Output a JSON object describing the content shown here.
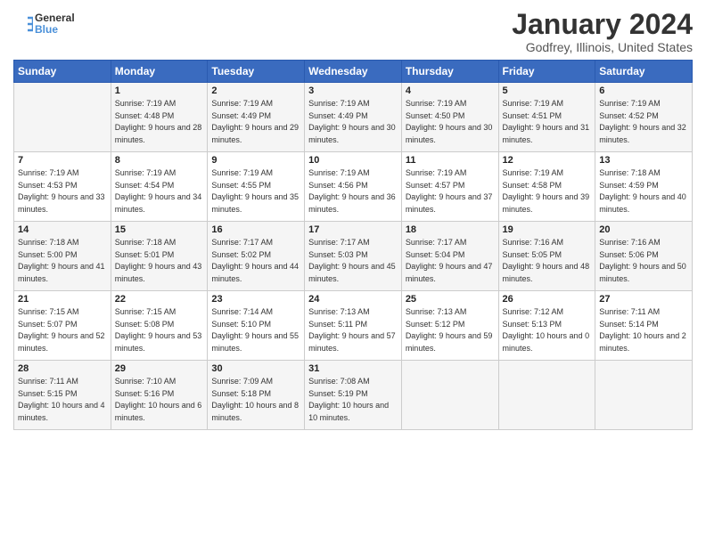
{
  "header": {
    "logo_line1": "General",
    "logo_line2": "Blue",
    "title": "January 2024",
    "location": "Godfrey, Illinois, United States"
  },
  "days_of_week": [
    "Sunday",
    "Monday",
    "Tuesday",
    "Wednesday",
    "Thursday",
    "Friday",
    "Saturday"
  ],
  "weeks": [
    [
      {
        "day": "",
        "sunrise": "",
        "sunset": "",
        "daylight": ""
      },
      {
        "day": "1",
        "sunrise": "Sunrise: 7:19 AM",
        "sunset": "Sunset: 4:48 PM",
        "daylight": "Daylight: 9 hours and 28 minutes."
      },
      {
        "day": "2",
        "sunrise": "Sunrise: 7:19 AM",
        "sunset": "Sunset: 4:49 PM",
        "daylight": "Daylight: 9 hours and 29 minutes."
      },
      {
        "day": "3",
        "sunrise": "Sunrise: 7:19 AM",
        "sunset": "Sunset: 4:49 PM",
        "daylight": "Daylight: 9 hours and 30 minutes."
      },
      {
        "day": "4",
        "sunrise": "Sunrise: 7:19 AM",
        "sunset": "Sunset: 4:50 PM",
        "daylight": "Daylight: 9 hours and 30 minutes."
      },
      {
        "day": "5",
        "sunrise": "Sunrise: 7:19 AM",
        "sunset": "Sunset: 4:51 PM",
        "daylight": "Daylight: 9 hours and 31 minutes."
      },
      {
        "day": "6",
        "sunrise": "Sunrise: 7:19 AM",
        "sunset": "Sunset: 4:52 PM",
        "daylight": "Daylight: 9 hours and 32 minutes."
      }
    ],
    [
      {
        "day": "7",
        "sunrise": "Sunrise: 7:19 AM",
        "sunset": "Sunset: 4:53 PM",
        "daylight": "Daylight: 9 hours and 33 minutes."
      },
      {
        "day": "8",
        "sunrise": "Sunrise: 7:19 AM",
        "sunset": "Sunset: 4:54 PM",
        "daylight": "Daylight: 9 hours and 34 minutes."
      },
      {
        "day": "9",
        "sunrise": "Sunrise: 7:19 AM",
        "sunset": "Sunset: 4:55 PM",
        "daylight": "Daylight: 9 hours and 35 minutes."
      },
      {
        "day": "10",
        "sunrise": "Sunrise: 7:19 AM",
        "sunset": "Sunset: 4:56 PM",
        "daylight": "Daylight: 9 hours and 36 minutes."
      },
      {
        "day": "11",
        "sunrise": "Sunrise: 7:19 AM",
        "sunset": "Sunset: 4:57 PM",
        "daylight": "Daylight: 9 hours and 37 minutes."
      },
      {
        "day": "12",
        "sunrise": "Sunrise: 7:19 AM",
        "sunset": "Sunset: 4:58 PM",
        "daylight": "Daylight: 9 hours and 39 minutes."
      },
      {
        "day": "13",
        "sunrise": "Sunrise: 7:18 AM",
        "sunset": "Sunset: 4:59 PM",
        "daylight": "Daylight: 9 hours and 40 minutes."
      }
    ],
    [
      {
        "day": "14",
        "sunrise": "Sunrise: 7:18 AM",
        "sunset": "Sunset: 5:00 PM",
        "daylight": "Daylight: 9 hours and 41 minutes."
      },
      {
        "day": "15",
        "sunrise": "Sunrise: 7:18 AM",
        "sunset": "Sunset: 5:01 PM",
        "daylight": "Daylight: 9 hours and 43 minutes."
      },
      {
        "day": "16",
        "sunrise": "Sunrise: 7:17 AM",
        "sunset": "Sunset: 5:02 PM",
        "daylight": "Daylight: 9 hours and 44 minutes."
      },
      {
        "day": "17",
        "sunrise": "Sunrise: 7:17 AM",
        "sunset": "Sunset: 5:03 PM",
        "daylight": "Daylight: 9 hours and 45 minutes."
      },
      {
        "day": "18",
        "sunrise": "Sunrise: 7:17 AM",
        "sunset": "Sunset: 5:04 PM",
        "daylight": "Daylight: 9 hours and 47 minutes."
      },
      {
        "day": "19",
        "sunrise": "Sunrise: 7:16 AM",
        "sunset": "Sunset: 5:05 PM",
        "daylight": "Daylight: 9 hours and 48 minutes."
      },
      {
        "day": "20",
        "sunrise": "Sunrise: 7:16 AM",
        "sunset": "Sunset: 5:06 PM",
        "daylight": "Daylight: 9 hours and 50 minutes."
      }
    ],
    [
      {
        "day": "21",
        "sunrise": "Sunrise: 7:15 AM",
        "sunset": "Sunset: 5:07 PM",
        "daylight": "Daylight: 9 hours and 52 minutes."
      },
      {
        "day": "22",
        "sunrise": "Sunrise: 7:15 AM",
        "sunset": "Sunset: 5:08 PM",
        "daylight": "Daylight: 9 hours and 53 minutes."
      },
      {
        "day": "23",
        "sunrise": "Sunrise: 7:14 AM",
        "sunset": "Sunset: 5:10 PM",
        "daylight": "Daylight: 9 hours and 55 minutes."
      },
      {
        "day": "24",
        "sunrise": "Sunrise: 7:13 AM",
        "sunset": "Sunset: 5:11 PM",
        "daylight": "Daylight: 9 hours and 57 minutes."
      },
      {
        "day": "25",
        "sunrise": "Sunrise: 7:13 AM",
        "sunset": "Sunset: 5:12 PM",
        "daylight": "Daylight: 9 hours and 59 minutes."
      },
      {
        "day": "26",
        "sunrise": "Sunrise: 7:12 AM",
        "sunset": "Sunset: 5:13 PM",
        "daylight": "Daylight: 10 hours and 0 minutes."
      },
      {
        "day": "27",
        "sunrise": "Sunrise: 7:11 AM",
        "sunset": "Sunset: 5:14 PM",
        "daylight": "Daylight: 10 hours and 2 minutes."
      }
    ],
    [
      {
        "day": "28",
        "sunrise": "Sunrise: 7:11 AM",
        "sunset": "Sunset: 5:15 PM",
        "daylight": "Daylight: 10 hours and 4 minutes."
      },
      {
        "day": "29",
        "sunrise": "Sunrise: 7:10 AM",
        "sunset": "Sunset: 5:16 PM",
        "daylight": "Daylight: 10 hours and 6 minutes."
      },
      {
        "day": "30",
        "sunrise": "Sunrise: 7:09 AM",
        "sunset": "Sunset: 5:18 PM",
        "daylight": "Daylight: 10 hours and 8 minutes."
      },
      {
        "day": "31",
        "sunrise": "Sunrise: 7:08 AM",
        "sunset": "Sunset: 5:19 PM",
        "daylight": "Daylight: 10 hours and 10 minutes."
      },
      {
        "day": "",
        "sunrise": "",
        "sunset": "",
        "daylight": ""
      },
      {
        "day": "",
        "sunrise": "",
        "sunset": "",
        "daylight": ""
      },
      {
        "day": "",
        "sunrise": "",
        "sunset": "",
        "daylight": ""
      }
    ]
  ]
}
